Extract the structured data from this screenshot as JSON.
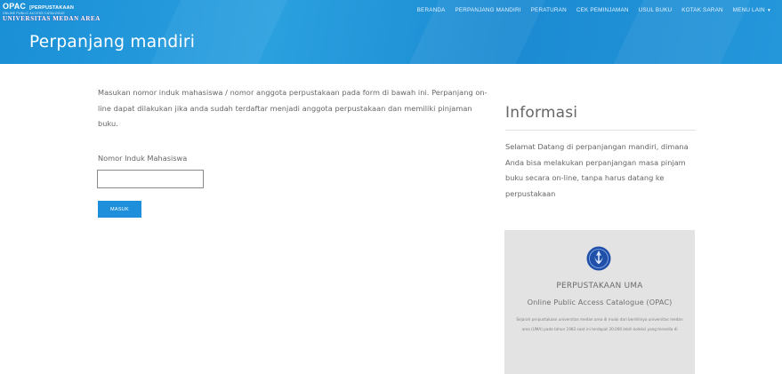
{
  "header": {
    "brand": {
      "opac": "OPAC",
      "perpustakaan": "[PERPUSTAKAAN",
      "tagline": "ONLINE PUBLIC ACCESS CATALOGUE",
      "university": "UNIVERSITAS MEDAN AREA"
    },
    "title": "Perpanjang mandiri",
    "nav": [
      {
        "label": "BERANDA"
      },
      {
        "label": "PERPANJANG MANDIRI"
      },
      {
        "label": "PERATURAN"
      },
      {
        "label": "CEK PEMINJAMAN"
      },
      {
        "label": "USUL BUKU"
      },
      {
        "label": "KOTAK SARAN"
      },
      {
        "label": "MENU LAIN"
      }
    ]
  },
  "main": {
    "intro": "Masukan nomor induk mahasiswa / nomor anggota perpustakaan pada form di bawah ini. Perpanjang on-line dapat dilakukan jika anda sudah terdaftar menjadi anggota perpustakaan dan memiliki pinjaman buku.",
    "field_label": "Nomor Induk Mahasiswa",
    "field_value": "",
    "field_placeholder": "",
    "submit_label": "MASUK"
  },
  "sidebar": {
    "title": "Informasi",
    "text": "Selamat Datang di perpanjangan mandiri, dimana Anda bisa melakukan perpanjangan masa pinjam buku secara on-line, tanpa harus datang ke perpustakaan",
    "card": {
      "title": "PERPUSTAKAAN UMA",
      "subtitle": "Online Public Access Catalogue (OPAC)",
      "description": "Sejarah perpustakaan universitas medan area di mulai dari berdirinya universitas medan area (UMA) pada tahun 1983 saat ini terdapat 30.000 lebih koleksi yang tersedia di"
    }
  },
  "colors": {
    "header_blue": "#1a8fd6",
    "button_blue": "#1e8fda",
    "card_bg": "#e3e3e3",
    "logo_blue": "#1f4fa8"
  }
}
